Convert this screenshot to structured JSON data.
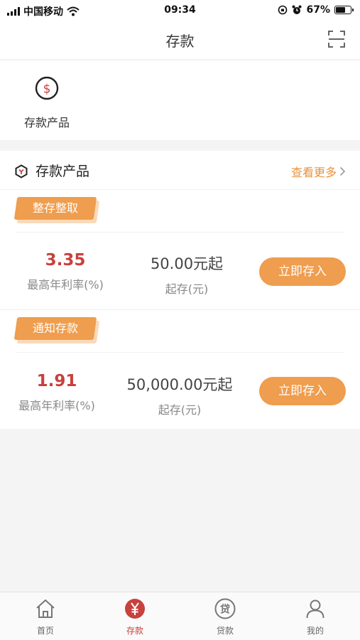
{
  "status_bar": {
    "carrier": "中国移动",
    "time": "09:34",
    "battery": "67%",
    "battery_level": 0.67
  },
  "nav": {
    "title": "存款"
  },
  "quick": {
    "label": "存款产品",
    "icon": "dollar-circle-icon"
  },
  "products": {
    "section_title": "存款产品",
    "more_label": "查看更多",
    "items": [
      {
        "tag": "整存整取",
        "rate": "3.35",
        "rate_label": "最高年利率(%)",
        "minimum": "50.00元起",
        "minimum_label": "起存(元)",
        "button": "立即存入"
      },
      {
        "tag": "通知存款",
        "rate": "1.91",
        "rate_label": "最高年利率(%)",
        "minimum": "50,000.00元起",
        "minimum_label": "起存(元)",
        "button": "立即存入"
      }
    ]
  },
  "tabs": [
    {
      "label": "首页",
      "icon": "home-icon",
      "active": false
    },
    {
      "label": "存款",
      "icon": "yuan-circle-icon",
      "active": true
    },
    {
      "label": "贷款",
      "icon": "loan-circle-icon",
      "active": false
    },
    {
      "label": "我的",
      "icon": "person-icon",
      "active": false
    }
  ],
  "colors": {
    "accent": "#ef9d4e",
    "rate_red": "#c8413d",
    "link_orange": "#e9913d"
  }
}
